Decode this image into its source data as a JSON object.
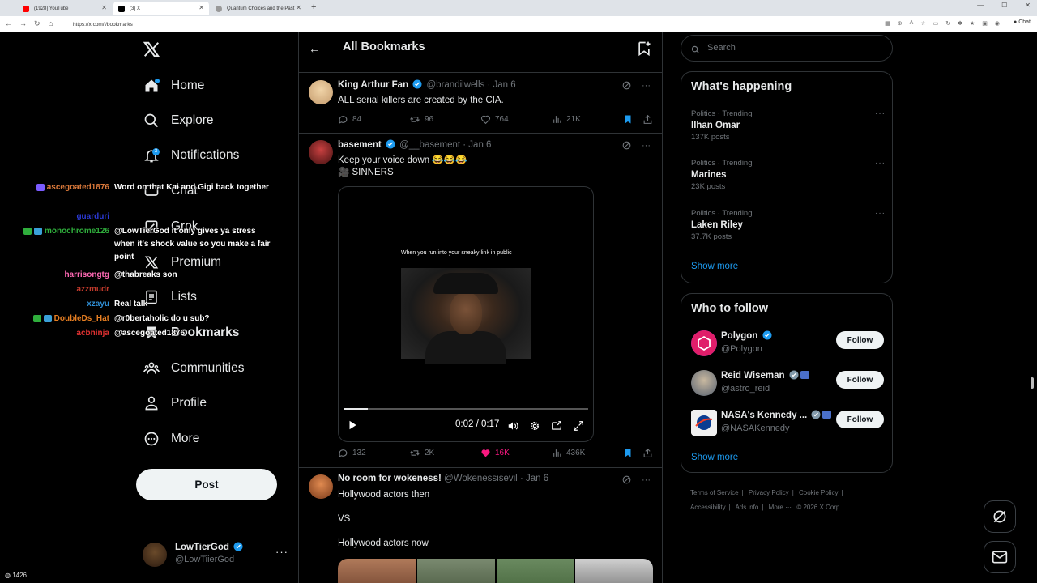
{
  "browser": {
    "tabs": [
      {
        "title": "(1928) YouTube",
        "color": "#ff0000"
      },
      {
        "title": "(3) X",
        "color": "#000000"
      },
      {
        "title": "Quantum Choices and the Past",
        "color": "#999999"
      }
    ],
    "url": "https://x.com/i/bookmarks",
    "chat_label": "Chat"
  },
  "nav": {
    "items": [
      {
        "label": "Home",
        "icon": "home-icon"
      },
      {
        "label": "Explore",
        "icon": "search-icon"
      },
      {
        "label": "Notifications",
        "icon": "bell-icon",
        "badge": "3"
      },
      {
        "label": "Chat",
        "icon": "chat-icon"
      },
      {
        "label": "Grok",
        "icon": "grok-icon"
      },
      {
        "label": "Premium",
        "icon": "x-icon"
      },
      {
        "label": "Lists",
        "icon": "list-icon"
      },
      {
        "label": "Bookmarks",
        "icon": "bookmark-icon"
      },
      {
        "label": "Communities",
        "icon": "communities-icon"
      },
      {
        "label": "Profile",
        "icon": "profile-icon"
      },
      {
        "label": "More",
        "icon": "more-icon"
      }
    ],
    "post_label": "Post",
    "account": {
      "name": "LowTierGod",
      "handle": "@LowTiierGod"
    }
  },
  "chat_overlay": {
    "messages": [
      {
        "user": "ascegoated1876",
        "color": "#d9783a",
        "text": "Word on that Kai and Gigi back together"
      },
      {
        "user": "guarduri",
        "color": "#2b3ad6",
        "text": ""
      },
      {
        "user": "monochrome126",
        "color": "#2fae3c",
        "text": "@LowTierGod it only gives ya stress when it's shock value so you make a fair point"
      },
      {
        "user": "harrisongtg",
        "color": "#ff69b4",
        "text": "@thabreaks son"
      },
      {
        "user": "azzmudr",
        "color": "#c0392b",
        "text": ""
      },
      {
        "user": "xzayu",
        "color": "#2f8fd6",
        "text": "Real talk"
      },
      {
        "user": "DoubleDs_Hat",
        "color": "#e67e22",
        "text": "@r0bertaholic do u sub?"
      },
      {
        "user": "acbninja",
        "color": "#e03131",
        "text": "@ascegoated1876"
      }
    ],
    "viewers": "1426"
  },
  "main": {
    "title": "All Bookmarks",
    "tweets": [
      {
        "name": "King Arthur Fan",
        "handle": "@brandilwells",
        "date": "· Jan 6",
        "text": "ALL serial killers are created by the CIA.",
        "replies": "84",
        "reposts": "96",
        "likes": "764",
        "views": "21K"
      },
      {
        "name": "basement",
        "handle": "@__basement",
        "date": "· Jan 6",
        "text1": "Keep your voice down 😂😂😂",
        "text2": "🎥 SINNERS",
        "video_caption": "When you run into your sneaky link in public",
        "video_time": "0:02 / 0:17",
        "video_progress": 0.1,
        "replies": "132",
        "reposts": "2K",
        "likes": "16K",
        "views": "436K"
      },
      {
        "name": "No room for wokeness!",
        "handle": "@Wokenessisevil",
        "date": "· Jan 6",
        "line1": "Hollywood actors then",
        "line2": "VS",
        "line3": "Hollywood actors now"
      }
    ]
  },
  "right": {
    "search_placeholder": "Search",
    "happening_title": "What's happening",
    "trends": [
      {
        "meta": "Politics · Trending",
        "name": "Ilhan Omar",
        "count": "137K posts"
      },
      {
        "meta": "Politics · Trending",
        "name": "Marines",
        "count": "23K posts"
      },
      {
        "meta": "Politics · Trending",
        "name": "Laken Riley",
        "count": "37.7K posts"
      }
    ],
    "show_more": "Show more",
    "who_title": "Who to follow",
    "follows": [
      {
        "name": "Polygon",
        "handle": "@Polygon"
      },
      {
        "name": "Reid Wiseman",
        "handle": "@astro_reid"
      },
      {
        "name": "NASA's Kennedy ...",
        "handle": "@NASAKennedy"
      }
    ],
    "follow_label": "Follow",
    "footer": [
      "Terms of Service",
      "|",
      "Privacy Policy",
      "|",
      "Cookie Policy",
      "|",
      "Accessibility",
      "|",
      "Ads info",
      "|",
      "More ···",
      "© 2026 X Corp."
    ]
  },
  "colors": {
    "accent": "#1d9bf0",
    "like": "#f91880",
    "background": "#000000"
  }
}
